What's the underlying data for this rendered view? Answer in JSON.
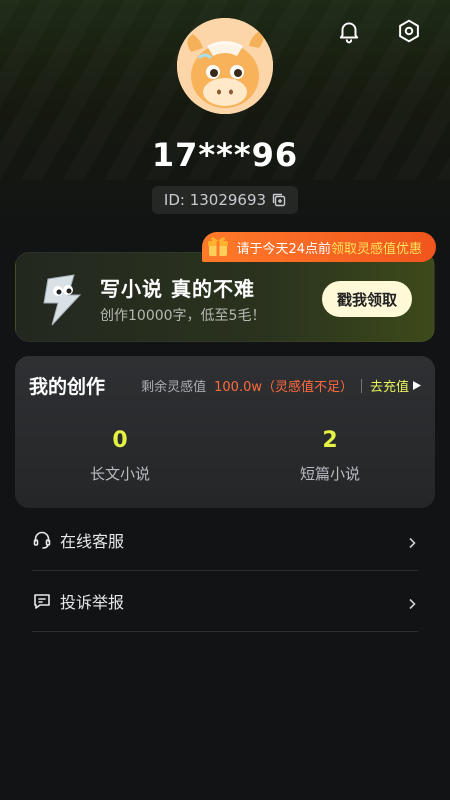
{
  "header": {
    "username": "17***96",
    "id_label": "ID: 13029693",
    "icons": [
      "bell-icon",
      "settings-icon",
      "copy-icon"
    ]
  },
  "promo_tag": {
    "text_prefix": "请于今天24点前",
    "text_highlight": "领取灵感值优惠"
  },
  "banner": {
    "title": "写小说 真的不难",
    "subtitle": "创作10000字，低至5毛！",
    "cta_label": "戳我领取"
  },
  "creations": {
    "title": "我的创作",
    "balance_label": "剩余灵感值",
    "balance_value": "100.0w（灵感值不足）",
    "recharge_label": "去充值",
    "stats": [
      {
        "count": "0",
        "label": "长文小说"
      },
      {
        "count": "2",
        "label": "短篇小说"
      }
    ]
  },
  "menu": [
    {
      "label": "在线客服",
      "icon": "headset-icon"
    },
    {
      "label": "投诉举报",
      "icon": "report-icon"
    }
  ],
  "colors": {
    "accent": "#e4f244",
    "warning": "#ff6a3d",
    "promo": "#f1551d",
    "background": "#111315"
  }
}
